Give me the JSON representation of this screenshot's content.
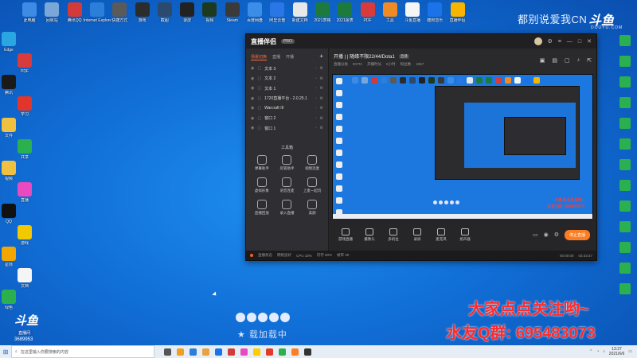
{
  "desktop": {
    "top_icons": [
      {
        "label": "此电脑",
        "color": "#3d8be5"
      },
      {
        "label": "回收站",
        "color": "#7aa7d8"
      },
      {
        "label": "腾讯QQ",
        "color": "#d33b3b"
      },
      {
        "label": "Internet Explorer",
        "color": "#2b7fd8"
      },
      {
        "label": "快捷方式",
        "color": "#5a5a5a"
      },
      {
        "label": "游戏",
        "color": "#2c2c2c"
      },
      {
        "label": "截图",
        "color": "#2c4a6e"
      },
      {
        "label": "录屏",
        "color": "#222222"
      },
      {
        "label": "视频",
        "color": "#1e3a1e"
      },
      {
        "label": "Steam",
        "color": "#3a3a3a"
      },
      {
        "label": "百度网盘",
        "color": "#3a8ee8"
      },
      {
        "label": "阿里云盘",
        "color": "#2b76e6"
      },
      {
        "label": "新建文档",
        "color": "#e8e8e8"
      },
      {
        "label": "2021表格",
        "color": "#1e7a3c"
      },
      {
        "label": "2021报表",
        "color": "#1e7a3c"
      },
      {
        "label": "PDF",
        "color": "#d83b3b"
      },
      {
        "label": "工具",
        "color": "#f08a24"
      },
      {
        "label": "斗鱼直播",
        "color": "#f5f5f5"
      },
      {
        "label": "酷狗音乐",
        "color": "#1a73e8"
      },
      {
        "label": "直播伴侣",
        "color": "#f7b500"
      }
    ],
    "left_icons": [
      {
        "label": "Edge",
        "color": "#2aa6e0"
      },
      {
        "label": "PDF",
        "color": "#d83b3b"
      },
      {
        "label": "腾讯",
        "color": "#1a1a1a"
      },
      {
        "label": "学习",
        "color": "#e2362c"
      },
      {
        "label": "文件",
        "color": "#f0c040"
      },
      {
        "label": "共享",
        "color": "#2ab04f"
      },
      {
        "label": "视频",
        "color": "#f0c040"
      },
      {
        "label": "直播",
        "color": "#e94abf"
      },
      {
        "label": "QQ",
        "color": "#111111"
      },
      {
        "label": "游戏",
        "color": "#f2c900"
      },
      {
        "label": "星际",
        "color": "#f2a600"
      },
      {
        "label": "文档",
        "color": "#f5f5f5"
      },
      {
        "label": "绿色",
        "color": "#2ab04f"
      }
    ],
    "right_icons_colors": [
      "#2ab04f",
      "#2ab04f",
      "#2ab04f",
      "#2ab04f",
      "#2ab04f",
      "#2ab04f",
      "#2ab04f",
      "#2ab04f",
      "#2ab04f",
      "#2ab04f",
      "#2ab04f",
      "#2ab04f",
      "#2ab04f"
    ]
  },
  "watermark": {
    "text": "都别说爱我CN",
    "logo": "斗鱼",
    "sub": "DOUYU.COM"
  },
  "app": {
    "name": "直播伴侣",
    "badge": "PRO",
    "left_tabs": [
      "场景切换",
      "直播",
      "开播"
    ],
    "scenes": [
      {
        "name": "文本 3"
      },
      {
        "name": "文本 2"
      },
      {
        "name": "文本 1"
      },
      {
        "name": "1720直播平台 - 2.0.25.1"
      },
      {
        "name": "Warcraft III"
      },
      {
        "name": "窗口 2"
      },
      {
        "name": "窗口 1"
      }
    ],
    "tools_title": "工具箱",
    "tools": [
      "弹幕助手",
      "房管助手",
      "视频连麦",
      "虚拟形象",
      "语音连麦",
      "上麦一起玩",
      "直播回放",
      "录入直播",
      "美颜"
    ],
    "stream_title": "开播 | | 随缘不限22/44/Dota1",
    "title_tag": "直播",
    "sub_info": [
      "直播分类",
      "DOTA",
      "开播时长",
      "5小时",
      "粉丝数",
      "1987"
    ],
    "viewers": "1067",
    "bottom_actions": [
      "游戏直播",
      "摄像头",
      "多机位",
      "录屏",
      "麦克风",
      "扬声器"
    ],
    "start_live": "停止直播",
    "status": [
      "直播状态",
      "网络良好",
      "CPU 18%",
      "内存 60%",
      "帧率 30"
    ],
    "status_time": "00:00:00",
    "rec_time": "03:43:47",
    "preview_red_text": [
      "大家点点关注哟~",
      "水友Q群: 695483073"
    ]
  },
  "overlay": {
    "loader_text": "★ 载加载中",
    "big_red_1": "大家点点关注哟~",
    "big_red_2": "水友Q群: 695483073",
    "side_logo": "斗鱼",
    "side_logo_sub": "直播间",
    "side_logo_num": "3689953"
  },
  "taskbar": {
    "search_placeholder": "在这里输入你要搜索的内容",
    "app_colors": [
      "#555555",
      "#f0a020",
      "#2b7fd8",
      "#e8a040",
      "#1a73e8",
      "#d33b3b",
      "#e94abf",
      "#ffcc00",
      "#e23a2a",
      "#2ab04f",
      "#ff7d22",
      "#333333"
    ],
    "time": "13:27",
    "date": "2021/6/6"
  }
}
